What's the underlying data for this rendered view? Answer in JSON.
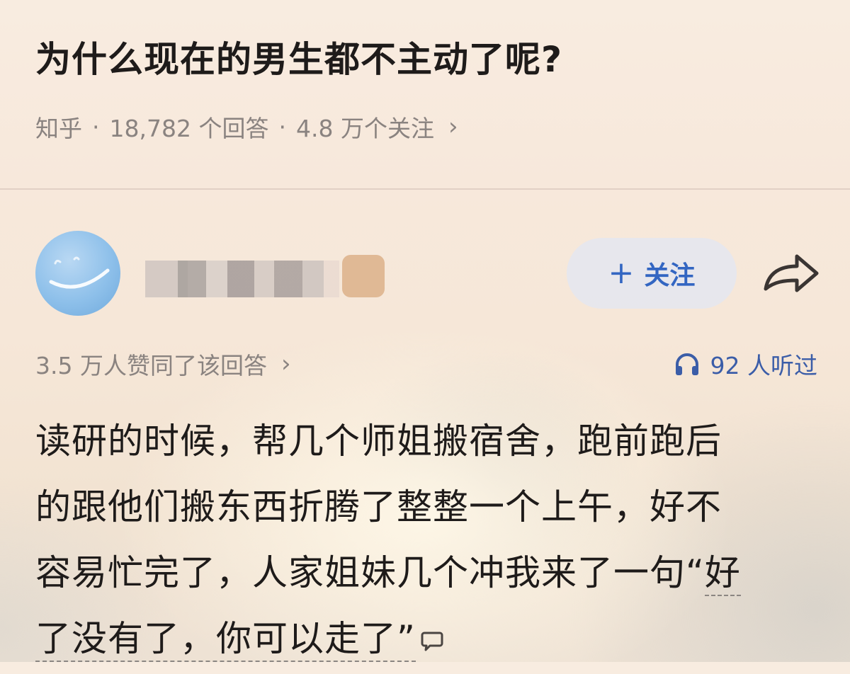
{
  "question": {
    "title": "为什么现在的男生都不主动了呢?",
    "source": "知乎",
    "separator": "·",
    "answer_count": "18,782 个回答",
    "follower_count": "4.8 万个关注",
    "chevron": "›"
  },
  "author": {
    "avatar_icon": "smile-avatar-icon",
    "follow_label": "关注",
    "follow_plus": "+",
    "share_icon": "share-arrow-icon"
  },
  "stats": {
    "upvote_text": "3.5 万人赞同了该回答",
    "chevron": "›",
    "listen_text": "92 人听过",
    "listen_icon": "headphones-icon"
  },
  "answer": {
    "lines": [
      "读研的时候，帮几个师姐搬宿舍，跑前跑后",
      "的跟他们搬东西折腾了整整一个上午，好不",
      "容易忙完了，人家姐妹几个冲我来了一句“",
      "好",
      "了没有了，你可以走了”"
    ],
    "comment_icon": "comment-bubble-icon"
  },
  "colors": {
    "accent": "#3366c2",
    "text": "#1e1b1a",
    "meta": "#8a8380"
  }
}
